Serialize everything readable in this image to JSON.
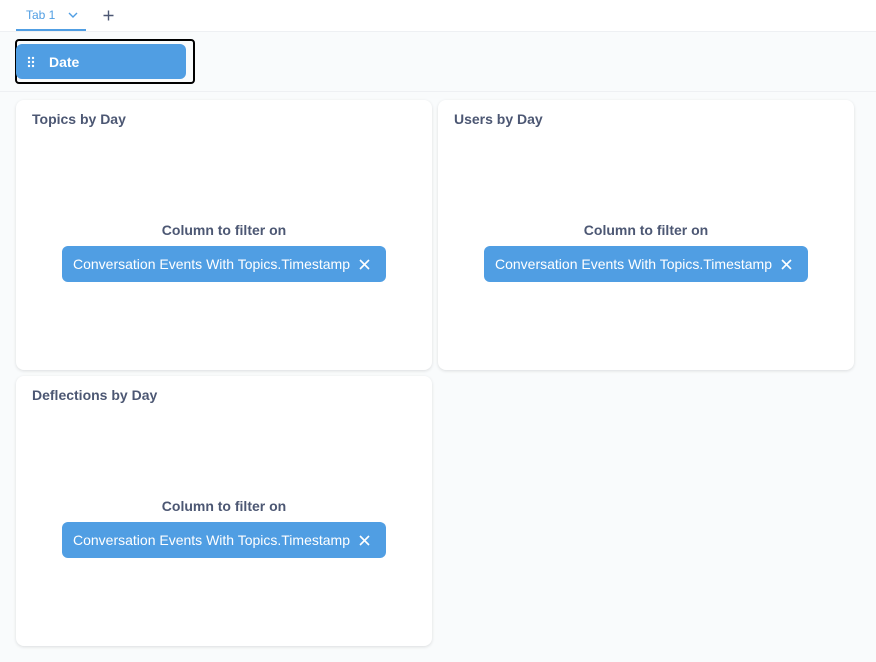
{
  "tabs": {
    "items": [
      {
        "label": "Tab 1",
        "selected": true
      }
    ],
    "add_icon": "plus-icon",
    "chevron_icon": "chevron-down-icon"
  },
  "filter": {
    "label": "Date",
    "handle_icon": "grip-icon"
  },
  "cards": [
    {
      "title": "Topics by Day",
      "column_label": "Column to filter on",
      "column_value": "Conversation Events With Topics.Timestamp",
      "remove_icon": "close-icon"
    },
    {
      "title": "Users by Day",
      "column_label": "Column to filter on",
      "column_value": "Conversation Events With Topics.Timestamp",
      "remove_icon": "close-icon"
    },
    {
      "title": "Deflections by Day",
      "column_label": "Column to filter on",
      "column_value": "Conversation Events With Topics.Timestamp",
      "remove_icon": "close-icon"
    }
  ],
  "colors": {
    "accent": "#509ee3",
    "text": "#4c5773",
    "background": "#f9fbfc"
  }
}
